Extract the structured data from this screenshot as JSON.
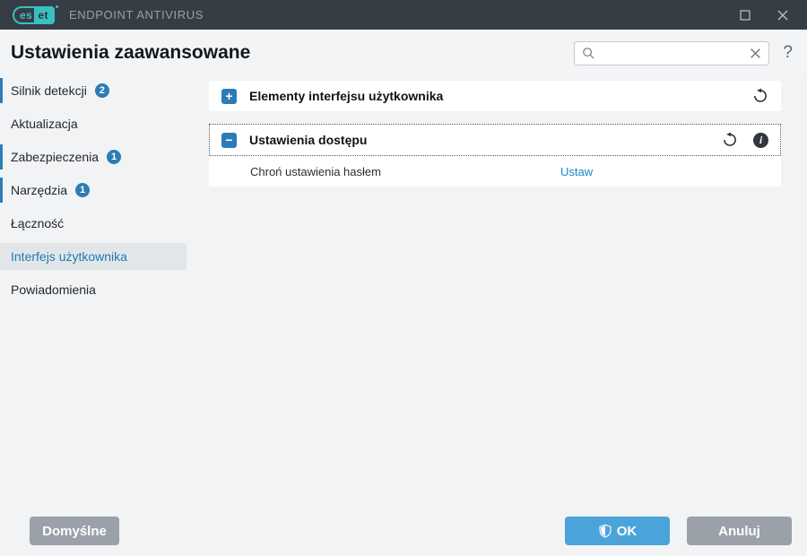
{
  "window": {
    "logo_left": "es",
    "logo_right": "et",
    "product_name": "ENDPOINT ANTIVIRUS"
  },
  "header": {
    "title": "Ustawienia zaawansowane",
    "search_placeholder": "",
    "search_value": "",
    "help_label": "?"
  },
  "sidebar": {
    "items": [
      {
        "label": "Silnik detekcji",
        "badge": "2",
        "accent": true,
        "selected": false
      },
      {
        "label": "Aktualizacja",
        "accent": false,
        "selected": false
      },
      {
        "label": "Zabezpieczenia",
        "badge": "1",
        "accent": true,
        "selected": false
      },
      {
        "label": "Narzędzia",
        "badge": "1",
        "accent": true,
        "selected": false
      },
      {
        "label": "Łączność",
        "accent": false,
        "selected": false
      },
      {
        "label": "Interfejs użytkownika",
        "accent": false,
        "selected": true
      },
      {
        "label": "Powiadomienia",
        "accent": false,
        "selected": false
      }
    ]
  },
  "main": {
    "panels": [
      {
        "title": "Elementy interfejsu użytkownika",
        "state": "collapsed",
        "toggle_glyph": "+",
        "icons": [
          "revert-icon"
        ]
      },
      {
        "title": "Ustawienia dostępu",
        "state": "expanded",
        "toggle_glyph": "−",
        "icons": [
          "revert-icon",
          "info-icon"
        ],
        "info_glyph": "i",
        "rows": [
          {
            "label": "Chroń ustawienia hasłem",
            "action": "Ustaw"
          }
        ]
      }
    ]
  },
  "footer": {
    "default_label": "Domyślne",
    "ok_label": "OK",
    "cancel_label": "Anuluj"
  },
  "icons": {
    "titlebar": [
      "maximize-icon",
      "close-icon"
    ],
    "search": [
      "search-icon",
      "clear-icon"
    ],
    "ok_button": "uac-shield-icon"
  },
  "colors": {
    "titlebar_bg": "#373d45",
    "eset_teal": "#3abfc3",
    "page_bg": "#f2f3f5",
    "panel_bg": "#ffffff",
    "accent_blue": "#2d7cb5",
    "toggle_blue": "#2a7cb8",
    "link_blue": "#1e87c7",
    "selected_text": "#1b7ab3",
    "selected_bg": "#e3e6e9",
    "ok_button_bg": "#4ba4d9",
    "gray_button_bg": "#9aa1a8",
    "dark_icon": "#31373d"
  }
}
